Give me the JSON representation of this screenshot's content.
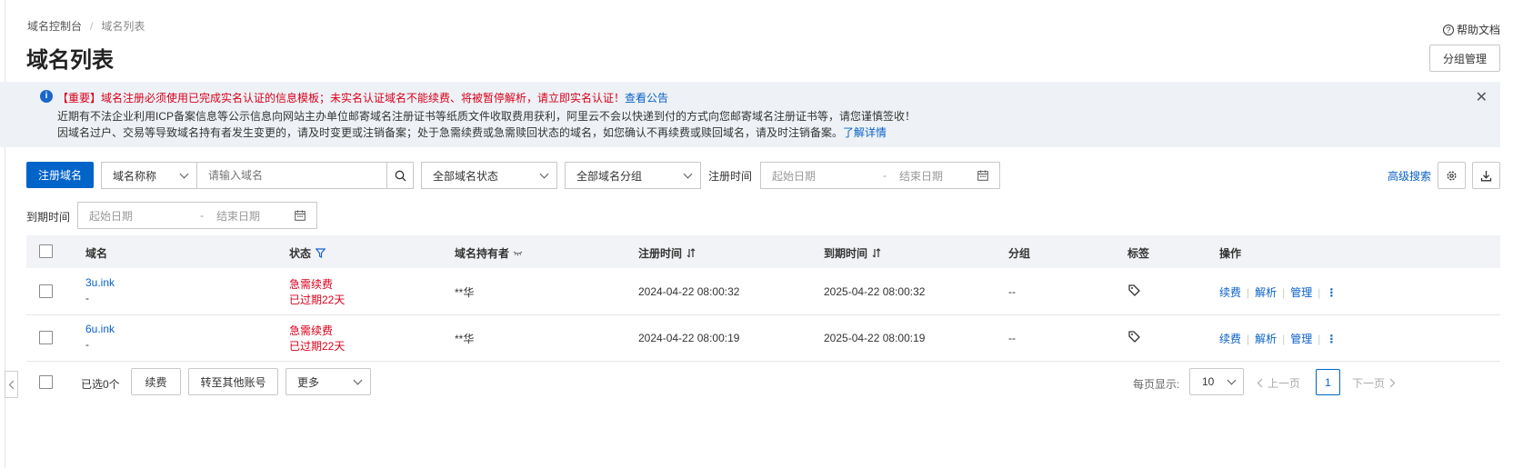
{
  "breadcrumb": {
    "root": "域名控制台",
    "separator": "/",
    "current": "域名列表"
  },
  "page_title": "域名列表",
  "header": {
    "help_label": "帮助文档",
    "group_manage_label": "分组管理"
  },
  "alert": {
    "line1_prefix": "【重要】域名注册必须使用已完成实名认证的信息模板；未实名认证域名不能续费、将被暂停解析，请立即实名认证！",
    "line1_link": "查看公告",
    "line2": "近期有不法企业利用ICP备案信息等公示信息向网站主办单位邮寄域名注册证书等纸质文件收取费用获利，阿里云不会以快递到付的方式向您邮寄域名注册证书等，请您谨慎签收！",
    "line3_prefix": "因域名过户、交易等导致域名持有者发生变更的，请及时变更或注销备案；处于急需续费或急需赎回状态的域名，如您确认不再续费或赎回域名，请及时注销备案。",
    "line3_link": "了解详情",
    "close_glyph": "✕"
  },
  "toolbar": {
    "register_label": "注册域名",
    "search_type": "域名称称",
    "search_placeholder": "请输入域名",
    "status_select": "全部域名状态",
    "group_select": "全部域名分组",
    "reg_time_label": "注册时间",
    "start_date": "起始日期",
    "date_sep": "-",
    "end_date": "结束日期",
    "advanced_search": "高级搜索",
    "expire_time_label": "到期时间"
  },
  "table": {
    "columns": {
      "domain": "域名",
      "status": "状态",
      "holder": "域名持有者",
      "reg_time": "注册时间",
      "expire_time": "到期时间",
      "group": "分组",
      "tags": "标签",
      "actions": "操作"
    },
    "rows": [
      {
        "domain": "3u.ink",
        "sub": "-",
        "status1": "急需续费",
        "status2": "已过期22天",
        "holder": "**华",
        "reg_time": "2024-04-22 08:00:32",
        "expire_time": "2025-04-22 08:00:32",
        "group": "--"
      },
      {
        "domain": "6u.ink",
        "sub": "-",
        "status1": "急需续费",
        "status2": "已过期22天",
        "holder": "**华",
        "reg_time": "2024-04-22 08:00:19",
        "expire_time": "2025-04-22 08:00:19",
        "group": "--"
      }
    ],
    "action_labels": {
      "renew": "续费",
      "resolve": "解析",
      "manage": "管理",
      "more": "⋮"
    }
  },
  "footer": {
    "selected": "已选0个",
    "renew": "续费",
    "transfer": "转至其他账号",
    "more": "更多",
    "page_size_label": "每页显示:",
    "page_size": "10",
    "prev": "上一页",
    "current_page": "1",
    "next": "下一页"
  },
  "colors": {
    "primary": "#0064c8",
    "link": "#0a60c7",
    "danger": "#d9001b"
  }
}
